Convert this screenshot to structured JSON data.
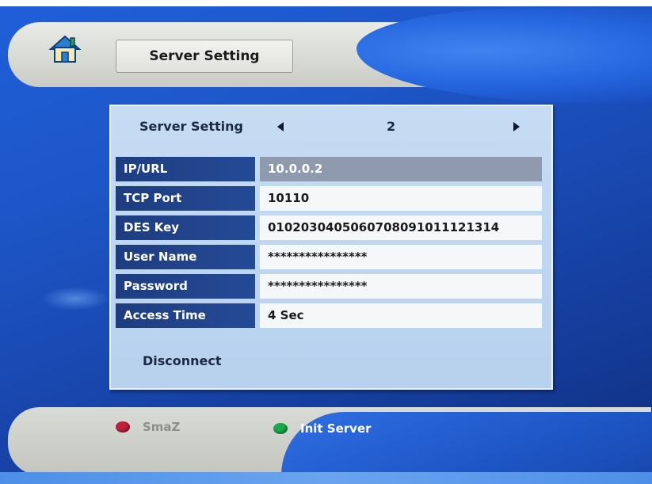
{
  "header": {
    "title": "Server Setting",
    "home_icon": "home-icon"
  },
  "panel": {
    "heading_label": "Server Setting",
    "selector_value": "2",
    "rows": [
      {
        "label": "IP/URL",
        "value": "10.0.0.2"
      },
      {
        "label": "TCP Port",
        "value": "10110"
      },
      {
        "label": "DES Key",
        "value": "0102030405060708091011121314"
      },
      {
        "label": "User Name",
        "value": "****************"
      },
      {
        "label": "Password",
        "value": "****************"
      },
      {
        "label": "Access Time",
        "value": "4 Sec"
      }
    ],
    "disconnect_label": "Disconnect"
  },
  "footer": {
    "red_button_label": "SmaZ",
    "green_button_label": "Init Server"
  },
  "colors": {
    "background": "#1d56c8",
    "panel": "#bdd5f0",
    "label_cell": "#1e3d80",
    "selected_value": "#8f9aae",
    "red_key": "#c0203a",
    "green_key": "#1aa84a"
  }
}
